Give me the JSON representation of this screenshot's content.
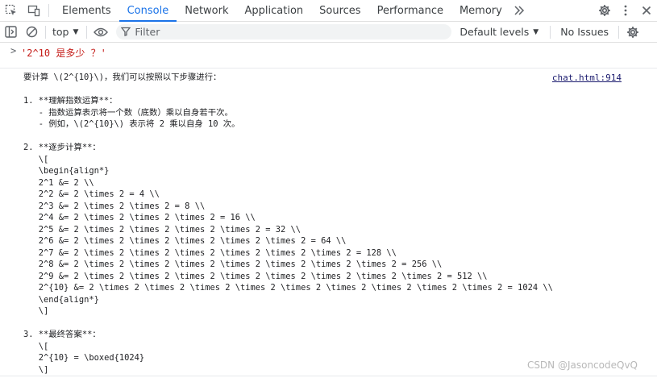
{
  "tabs": [
    {
      "label": "Elements",
      "active": false
    },
    {
      "label": "Console",
      "active": true
    },
    {
      "label": "Network",
      "active": false
    },
    {
      "label": "Application",
      "active": false
    },
    {
      "label": "Sources",
      "active": false
    },
    {
      "label": "Performance",
      "active": false
    },
    {
      "label": "Memory",
      "active": false
    }
  ],
  "toolbar": {
    "context": "top",
    "filter_placeholder": "Filter",
    "levels": "Default levels",
    "issues": "No Issues"
  },
  "console": {
    "prompt": "'2^10 是多少 ？'",
    "source": "chat.html:914",
    "lines": [
      "要计算 \\(2^{10}\\)，我们可以按照以下步骤进行：",
      "",
      "1. **理解指数运算**：",
      "   - 指数运算表示将一个数（底数）乘以自身若干次。",
      "   - 例如，\\(2^{10}\\) 表示将 2 乘以自身 10 次。",
      "",
      "2. **逐步计算**：",
      "   \\[",
      "   \\begin{align*}",
      "   2^1 &= 2 \\\\",
      "   2^2 &= 2 \\times 2 = 4 \\\\",
      "   2^3 &= 2 \\times 2 \\times 2 = 8 \\\\",
      "   2^4 &= 2 \\times 2 \\times 2 \\times 2 = 16 \\\\",
      "   2^5 &= 2 \\times 2 \\times 2 \\times 2 \\times 2 = 32 \\\\",
      "   2^6 &= 2 \\times 2 \\times 2 \\times 2 \\times 2 \\times 2 = 64 \\\\",
      "   2^7 &= 2 \\times 2 \\times 2 \\times 2 \\times 2 \\times 2 \\times 2 = 128 \\\\",
      "   2^8 &= 2 \\times 2 \\times 2 \\times 2 \\times 2 \\times 2 \\times 2 \\times 2 = 256 \\\\",
      "   2^9 &= 2 \\times 2 \\times 2 \\times 2 \\times 2 \\times 2 \\times 2 \\times 2 \\times 2 = 512 \\\\",
      "   2^{10} &= 2 \\times 2 \\times 2 \\times 2 \\times 2 \\times 2 \\times 2 \\times 2 \\times 2 \\times 2 = 1024 \\\\",
      "   \\end{align*}",
      "   \\]",
      "",
      "3. **最终答案**：",
      "   \\[",
      "   2^{10} = \\boxed{1024}",
      "   \\]"
    ]
  },
  "watermark": "CSDN @JasoncodeQvQ",
  "icons": {
    "inspect": "inspect-element-icon",
    "device": "device-toggle-icon",
    "more_tabs": "more-tabs-icon",
    "settings": "gear-icon",
    "menu": "kebab-menu-icon",
    "close": "close-icon",
    "sidebar": "sidebar-toggle-icon",
    "clear": "clear-console-icon",
    "eye": "eye-icon",
    "filter": "filter-icon"
  },
  "colors": {
    "accent": "#1a73e8",
    "prompt": "#c41a16"
  }
}
